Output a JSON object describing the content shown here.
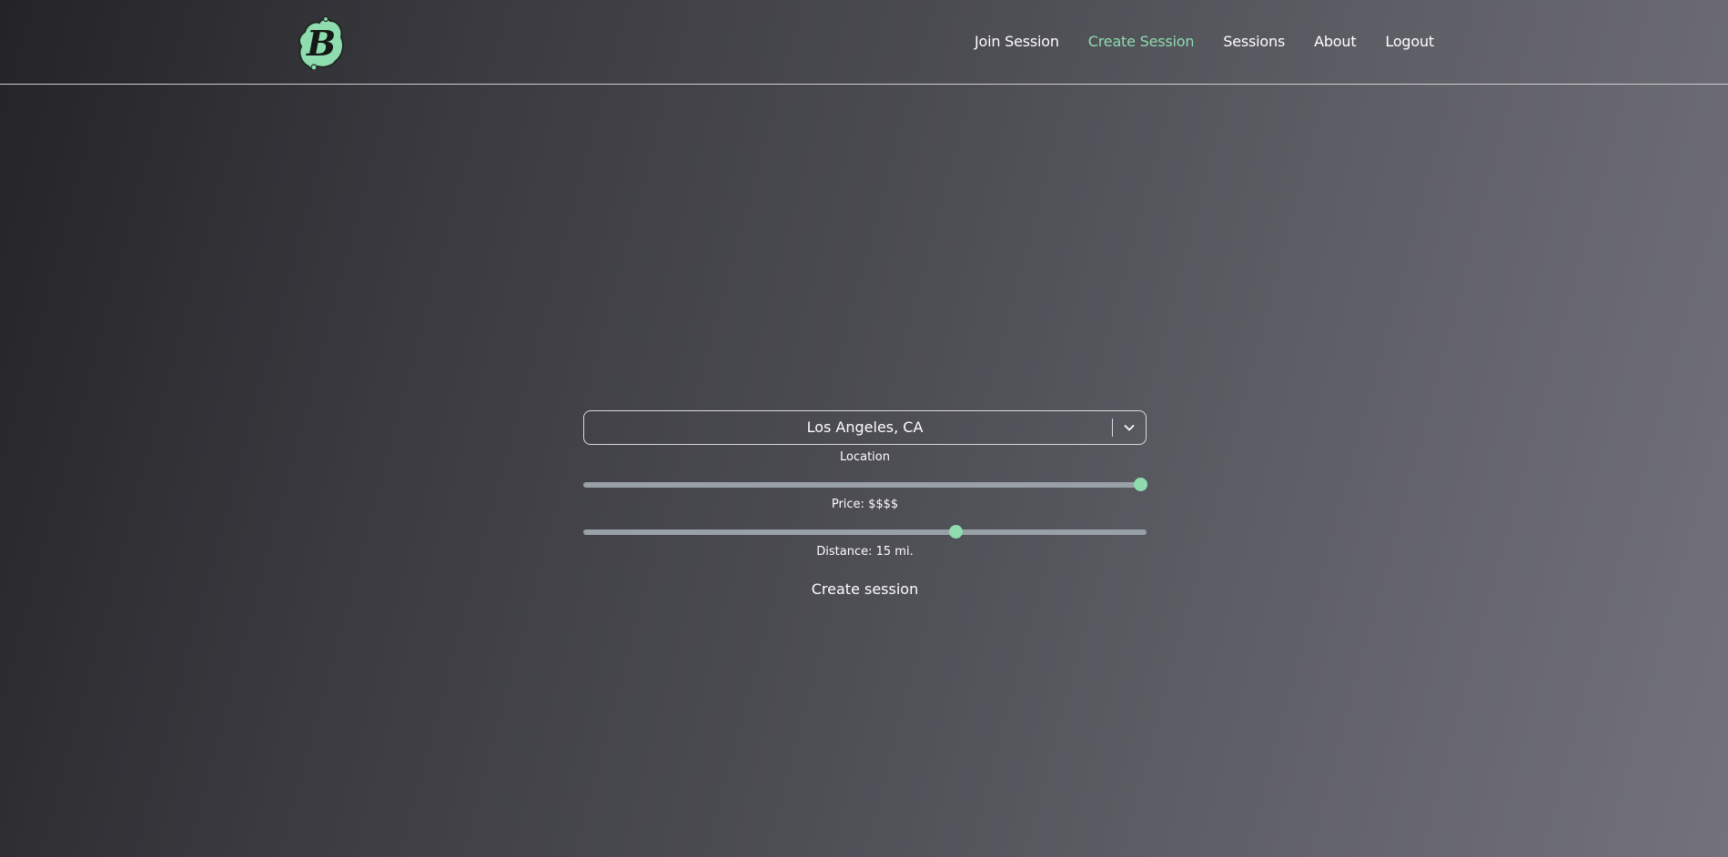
{
  "colors": {
    "accent": "#8fdcaf",
    "text": "#ffffff",
    "track": "#9aa0a8"
  },
  "header": {
    "logo_icon": "b-logo-icon",
    "nav": [
      {
        "label": "Join Session",
        "active": false
      },
      {
        "label": "Create Session",
        "active": true
      },
      {
        "label": "Sessions",
        "active": false
      },
      {
        "label": "About",
        "active": false
      },
      {
        "label": "Logout",
        "active": false
      }
    ]
  },
  "form": {
    "location": {
      "value": "Los Angeles, CA",
      "caption": "Location",
      "icon": "chevron-down-icon"
    },
    "price": {
      "caption": "Price: $$$$",
      "level": 1.0
    },
    "distance": {
      "caption": "Distance: 15 mi.",
      "level": 0.664
    },
    "submit_label": "Create session"
  }
}
